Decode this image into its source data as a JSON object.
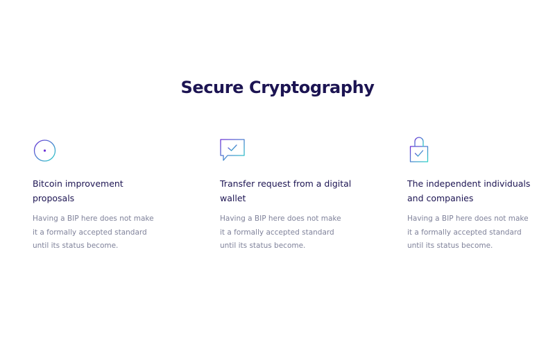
{
  "section": {
    "title": "Secure Cryptography"
  },
  "gradient": {
    "start": "#6b2fd6",
    "end": "#2ad3c8"
  },
  "features": [
    {
      "icon": "stopwatch-icon",
      "title": "Bitcoin improvement proposals",
      "description": "Having a BIP here does not make it a formally accepted standard until its status become."
    },
    {
      "icon": "message-check-icon",
      "title": "Transfer request from a digital wallet",
      "description": "Having a BIP here does not make it a formally accepted standard until its status become."
    },
    {
      "icon": "shopping-bag-check-icon",
      "title": "The independent individuals and companies",
      "description": "Having a BIP here does not make it a formally accepted standard until its status become."
    }
  ]
}
